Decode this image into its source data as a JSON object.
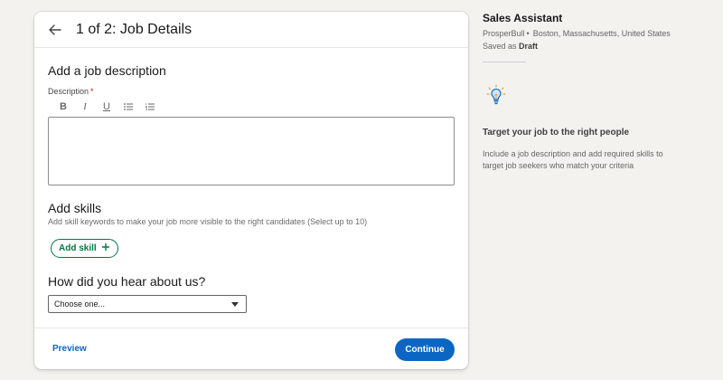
{
  "header": {
    "title": "1 of 2: Job Details"
  },
  "description": {
    "section_title": "Add a job description",
    "label": "Description",
    "required_marker": "*",
    "value": ""
  },
  "toolbar": {
    "bold": "B",
    "italic": "I",
    "underline": "U"
  },
  "skills": {
    "section_title": "Add skills",
    "subtitle": "Add skill keywords to make your job more visible to the right candidates (Select up to 10)",
    "add_label": "Add skill"
  },
  "referral": {
    "question": "How did you hear about us?",
    "selected": "Choose one..."
  },
  "footer": {
    "preview": "Preview",
    "continue": "Continue"
  },
  "sidebar": {
    "job_title": "Sales Assistant",
    "company": "ProsperBull",
    "location": "Boston, Massachusetts, United States",
    "saved_prefix": "Saved as",
    "saved_state": "Draft",
    "tip_heading": "Target your job to the right people",
    "tip_body": "Include a job description and add required skills to target job seekers who match your criteria"
  },
  "colors": {
    "primary": "#0a66c2",
    "skill_green": "#057642",
    "required_red": "#cc1016",
    "bulb_blue": "#0a66c2",
    "bulb_yellow": "#e7a33e"
  },
  "icons": {
    "back": "arrow-left-icon",
    "bold": "bold-icon",
    "italic": "italic-icon",
    "underline": "underline-icon",
    "bullet_list": "bullet-list-icon",
    "numbered_list": "numbered-list-icon",
    "add_skill": "plus-icon",
    "dropdown": "caret-down-icon",
    "tip": "lightbulb-icon"
  }
}
